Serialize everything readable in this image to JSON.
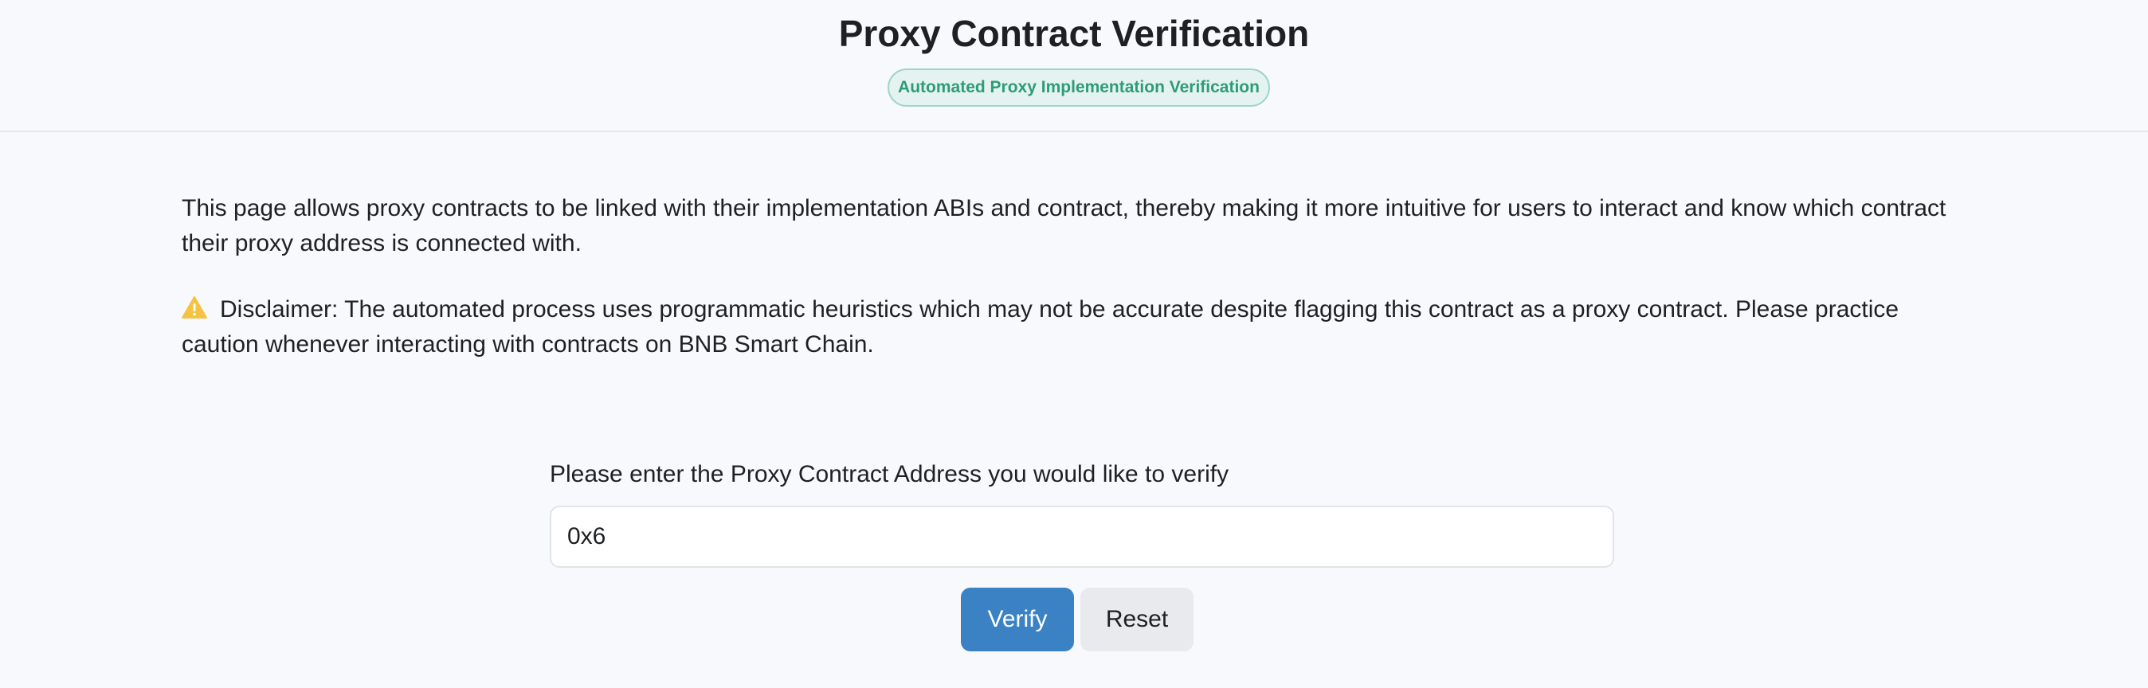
{
  "header": {
    "title": "Proxy Contract Verification",
    "badge": "Automated Proxy Implementation Verification"
  },
  "content": {
    "intro": "This page allows proxy contracts to be linked with their implementation ABIs and contract, thereby making it more intuitive for users to interact and know which contract their proxy address is connected with.",
    "disclaimer_icon": "warning-triangle-icon",
    "disclaimer": "Disclaimer: The automated process uses programmatic heuristics which may not be accurate despite flagging this contract as a proxy contract. Please practice caution whenever interacting with contracts on BNB Smart Chain."
  },
  "form": {
    "label": "Please enter the Proxy Contract Address you would like to verify",
    "address_value": "0x6",
    "verify_label": "Verify",
    "reset_label": "Reset"
  },
  "colors": {
    "accent": "#3a82c4",
    "badge_text": "#2e9b79",
    "warning": "#f5c242"
  }
}
